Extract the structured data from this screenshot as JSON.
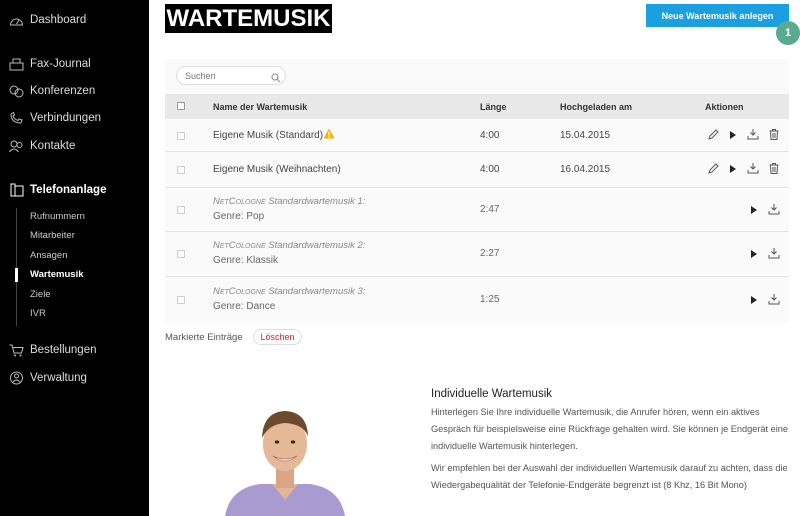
{
  "sidebar": {
    "main_items": [
      {
        "label": "Dashboard",
        "icon": "dashboard-icon"
      },
      {
        "label": "Fax-Journal",
        "icon": "fax-icon"
      },
      {
        "label": "Konferenzen",
        "icon": "conference-icon"
      },
      {
        "label": "Verbindungen",
        "icon": "phone-icon"
      },
      {
        "label": "Kontakte",
        "icon": "contacts-icon"
      },
      {
        "label": "Telefonanlage",
        "icon": "telephone-system-icon"
      }
    ],
    "sub_items": [
      "Rufnummern",
      "Mitarbeiter",
      "Ansagen",
      "Wartemusik",
      "Ziele",
      "IVR"
    ],
    "bottom_items": [
      {
        "label": "Bestellungen",
        "icon": "cart-icon"
      },
      {
        "label": "Verwaltung",
        "icon": "admin-icon"
      }
    ]
  },
  "header": {
    "logo_text": "WARTEMUSIK",
    "new_button": "Neue Wartemusik anlegen",
    "badge": "1"
  },
  "search": {
    "placeholder": "Suchen"
  },
  "table": {
    "columns": [
      "Name der Wartemusik",
      "Länge",
      "Hochgeladen am",
      "Aktionen"
    ],
    "rows": [
      {
        "name": "Eigene Musik (Standard)",
        "length": "4:00",
        "date": "15.04.2015",
        "warning": true
      },
      {
        "name": "Eigene Musik (Weihnachten)",
        "length": "4:00",
        "date": "16.04.2015"
      }
    ],
    "standard_rows": [
      {
        "brand": "NetCologne",
        "title": " Standardwartemusik 1:",
        "genre": "Genre: Pop",
        "length": "2:47"
      },
      {
        "brand": "NetCologne",
        "title": " Standardwartemusik 2:",
        "genre": "Genre: Klassik",
        "length": "2:27"
      },
      {
        "brand": "NetCologne",
        "title": " Standardwartemusik 3:",
        "genre": "Genre: Dance",
        "length": "1:25"
      }
    ]
  },
  "footer_actions": {
    "marked_label": "Markierte Einträge",
    "delete_button": "Löschen"
  },
  "info": {
    "title": "Individuelle Wartemusik",
    "paragraph1": "Hinterlegen Sie Ihre individuelle Wartemusik, die Anrufer hören, wenn ein aktives Gespräch für beispielsweise eine Rückfrage gehalten wird. Sie können je Endgerät eine individuelle Wartemusik hinterlegen.",
    "paragraph2": "Wir empfehlen bei der Auswahl der individuellen Wartemusik darauf zu achten, dass die Wiedergabequalität der Telefonie-Endgeräte begrenzt ist (8 Khz, 16 Bit Mono)"
  },
  "colors": {
    "accent": "#1a9fe0",
    "badge": "#5aab8e",
    "warning": "#f0b400",
    "delete": "#dd2222"
  }
}
